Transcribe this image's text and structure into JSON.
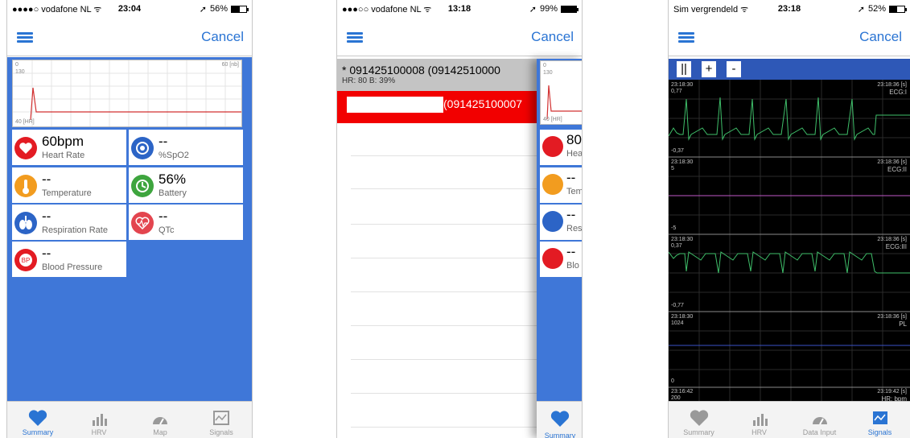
{
  "phone1": {
    "status": {
      "carrier": "●●●●○ vodafone NL ᯤ",
      "time": "23:04",
      "battery": "56%"
    },
    "cancel": "Cancel",
    "chart": {
      "x_min": "0",
      "x_max": "60 [nb]",
      "y_top": "130",
      "y_bottom": "40 [HR]"
    },
    "tiles": [
      {
        "value": "60bpm",
        "label": "Heart Rate",
        "icon": "heart-icon",
        "color": "#e31b23"
      },
      {
        "value": "--",
        "label": "%SpO2",
        "icon": "spo2-icon",
        "color": "#2c64c6"
      },
      {
        "value": "--",
        "label": "Temperature",
        "icon": "thermometer-icon",
        "color": "#f29c1f"
      },
      {
        "value": "56%",
        "label": "Battery",
        "icon": "battery-icon",
        "color": "#3ea53e"
      },
      {
        "value": "--",
        "label": "Respiration Rate",
        "icon": "lungs-icon",
        "color": "#2c64c6"
      },
      {
        "value": "--",
        "label": "QTc",
        "icon": "qtc-heart-icon",
        "color": "#e3454f"
      },
      {
        "value": "--",
        "label": "Blood Pressure",
        "icon": "blood-pressure-icon",
        "color": "#e31b23"
      }
    ],
    "tabs": [
      {
        "label": "Summary",
        "icon": "heart-icon",
        "active": true
      },
      {
        "label": "HRV",
        "icon": "bar-chart-icon",
        "active": false
      },
      {
        "label": "Map",
        "icon": "gauge-icon",
        "active": false
      },
      {
        "label": "Signals",
        "icon": "signal-chart-icon",
        "active": false
      }
    ]
  },
  "phone2": {
    "status": {
      "carrier": "●●●○○ vodafone NL ᯤ",
      "time": "13:18",
      "battery": "99%"
    },
    "cancel": "Cancel",
    "device_title": "* 091425100008 (09142510000",
    "device_sub": "HR: 80  B: 39%",
    "red_row_text": "(091425100007",
    "overlay": {
      "y_top_a": "0",
      "y_top_b": "130",
      "y_bottom": "40 [HR]",
      "tiles": [
        "80",
        "--",
        "--",
        "--"
      ],
      "tile_labels": [
        "Hea",
        "Tem",
        "Res",
        "Blo"
      ],
      "tab": "Summary"
    }
  },
  "phone3": {
    "status": {
      "carrier": "Sim vergrendeld ᯤ",
      "time": "23:18",
      "battery": "52%"
    },
    "cancel": "Cancel",
    "buttons": [
      "||",
      "+",
      "-"
    ],
    "channels": [
      {
        "t_start": "23:18:30",
        "t_end": "23:18:36 [s]",
        "max": "0,77",
        "min": "-0,37",
        "name": "ECG:I"
      },
      {
        "t_start": "23:18:30",
        "t_end": "23:18:36 [s]",
        "max": "5",
        "min": "-5",
        "name": "ECG:II"
      },
      {
        "t_start": "23:18:30",
        "t_end": "23:18:36 [s]",
        "max": "0,37",
        "min": "-0,77",
        "name": "ECG:III"
      },
      {
        "t_start": "23:18:30",
        "t_end": "23:18:36 [s]",
        "max": "1024",
        "min": "0",
        "name": "PL"
      },
      {
        "t_start": "23:16:42",
        "t_end": "23:19:42 [s]",
        "max": "200",
        "min": "",
        "name": "HR: bpm"
      }
    ],
    "tabs": [
      {
        "label": "Summary",
        "icon": "heart-icon",
        "active": false
      },
      {
        "label": "HRV",
        "icon": "bar-chart-icon",
        "active": false
      },
      {
        "label": "Data Input",
        "icon": "gauge-icon",
        "active": false
      },
      {
        "label": "Signals",
        "icon": "signal-chart-icon",
        "active": true
      }
    ]
  }
}
